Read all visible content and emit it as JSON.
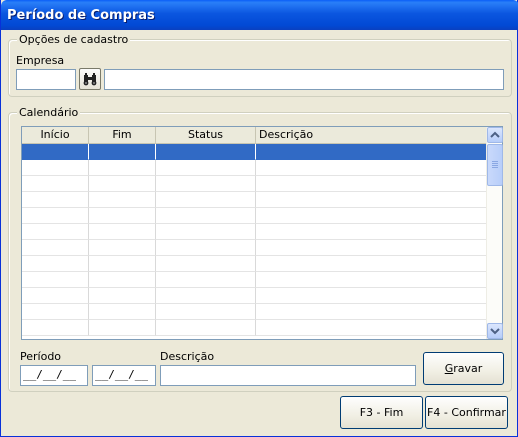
{
  "window": {
    "title": "Período de Compras"
  },
  "cadastro": {
    "legend": "Opções de cadastro",
    "empresa_label": "Empresa",
    "empresa_code": "",
    "empresa_name": ""
  },
  "calendario": {
    "legend": "Calendário",
    "columns": [
      "Início",
      "Fim",
      "Status",
      "Descrição"
    ],
    "rows": []
  },
  "form": {
    "periodo_label": "Período",
    "periodo_start": "__/__/__",
    "periodo_end": "__/__/__",
    "descricao_label": "Descrição",
    "descricao_value": "",
    "gravar_label": "Gravar"
  },
  "footer": {
    "f3_label": "F3 - Fim",
    "f4_label": "F4 - Confirmar"
  },
  "colors": {
    "title_bar": "#0b56e0",
    "selection": "#316ac5",
    "face": "#ece9d8"
  }
}
